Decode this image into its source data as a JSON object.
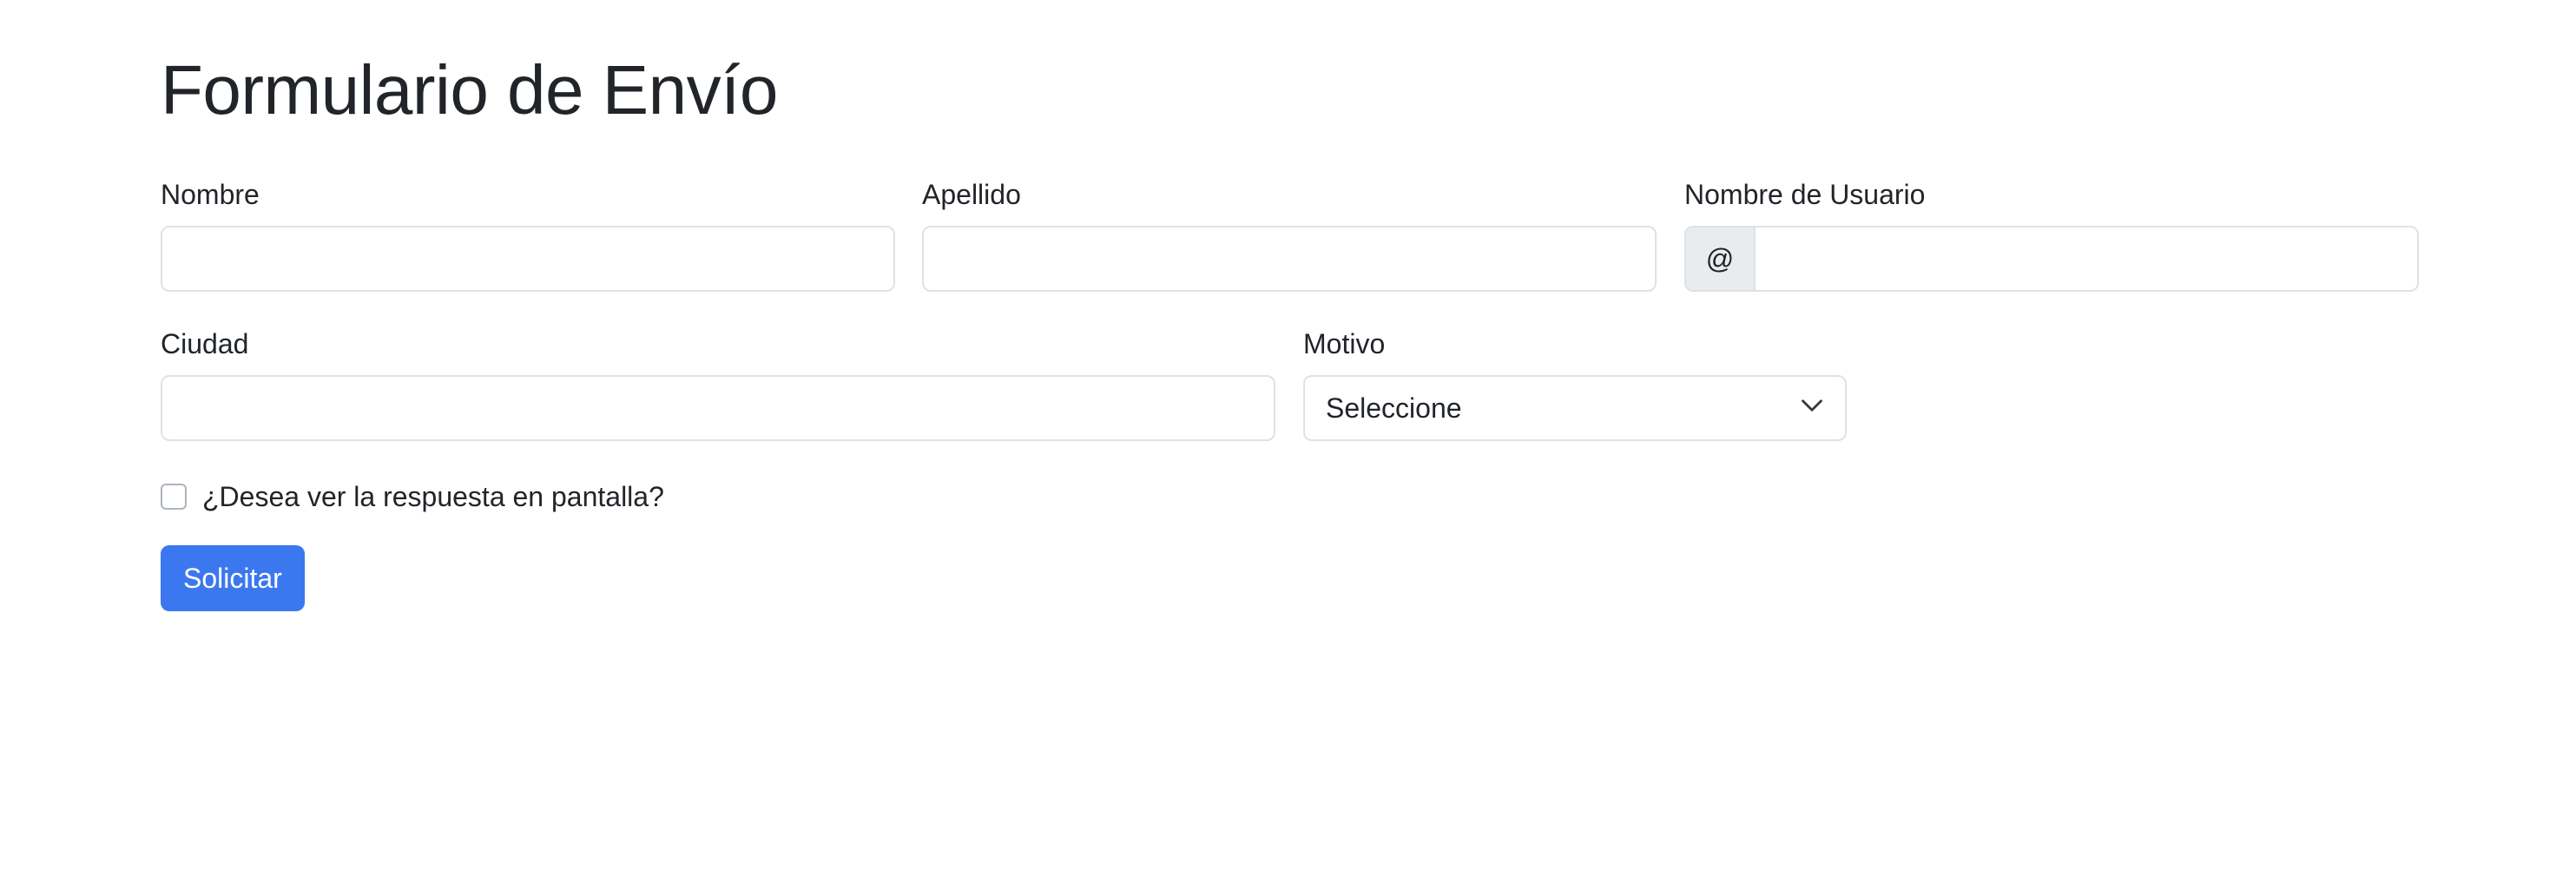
{
  "page": {
    "title": "Formulario de Envío"
  },
  "form": {
    "nombre": {
      "label": "Nombre",
      "value": ""
    },
    "apellido": {
      "label": "Apellido",
      "value": ""
    },
    "usuario": {
      "label": "Nombre de Usuario",
      "prefix": "@",
      "value": ""
    },
    "ciudad": {
      "label": "Ciudad",
      "value": ""
    },
    "motivo": {
      "label": "Motivo",
      "selected": "Seleccione"
    },
    "mostrar_respuesta": {
      "label": "¿Desea ver la respuesta en pantalla?",
      "checked": false
    },
    "submit_label": "Solicitar"
  },
  "colors": {
    "primary": "#3b78f0",
    "text": "#212529",
    "border": "#dee2e6",
    "addon_bg": "#e9ecef"
  },
  "icons": {
    "select_arrow": "chevron-down-icon"
  }
}
